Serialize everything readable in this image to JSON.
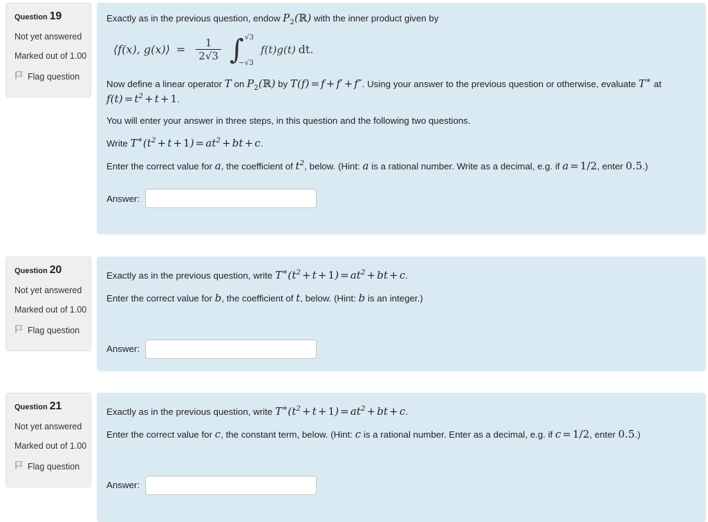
{
  "questions": [
    {
      "heading_label": "Question",
      "number": "19",
      "state": "Not yet answered",
      "grade": "Marked out of 1.00",
      "flag_label": "Flag question",
      "flag_icon": "flag-icon",
      "intro_before_math": "Exactly as in the previous question, endow ",
      "intro_math": "P₂(ℝ)",
      "intro_after_math": " with the inner product given by",
      "equation": {
        "lhs": "⟨f(x), g(x)⟩",
        "equals": "=",
        "fraction_numerator": "1",
        "fraction_denominator": "2√3",
        "integral_upper": "√3",
        "integral_lower": "−√3",
        "integrand": "f(t)g(t)",
        "differential": "dt."
      },
      "para_operator": {
        "t1": "Now define a linear operator ",
        "m1": "T",
        "t2": " on ",
        "m2": "P₂(ℝ)",
        "t3": " by ",
        "m3": "T(f) = f + f′ + f″",
        "t4": ". Using your answer to the previous question or otherwise, evaluate ",
        "m4": "T*",
        "t5": " at ",
        "m5": "f(t) = t² + t + 1",
        "t6": "."
      },
      "para_steps": "You will enter your answer in three steps, in this question and the following two questions.",
      "para_write": {
        "t1": "Write ",
        "m1": "T*(t² + t + 1) = at² + bt + c",
        "t2": "."
      },
      "para_enter": {
        "t1": "Enter the correct value for ",
        "m1": "a",
        "t2": ", the coefficient of ",
        "m2": "t²",
        "t3": ", below. (Hint: ",
        "m3": "a",
        "t4": " is a rational number. Write as a decimal, e.g. if ",
        "m4": "a = 1/2",
        "t5": ", enter ",
        "m5": "0.5",
        "t6": ".)"
      },
      "answer_label": "Answer:",
      "answer_value": "",
      "answer_placeholder": ""
    },
    {
      "heading_label": "Question",
      "number": "20",
      "state": "Not yet answered",
      "grade": "Marked out of 1.00",
      "flag_label": "Flag question",
      "flag_icon": "flag-icon",
      "para_write": {
        "t1": "Exactly as in the previous question, write ",
        "m1": "T*(t² + t + 1) = at² + bt + c",
        "t2": "."
      },
      "para_enter": {
        "t1": "Enter the correct value for ",
        "m1": "b",
        "t2": ", the coefficient of ",
        "m2": "t",
        "t3": ", below. (Hint: ",
        "m3": "b",
        "t4": " is an integer.)"
      },
      "answer_label": "Answer:",
      "answer_value": "",
      "answer_placeholder": ""
    },
    {
      "heading_label": "Question",
      "number": "21",
      "state": "Not yet answered",
      "grade": "Marked out of 1.00",
      "flag_label": "Flag question",
      "flag_icon": "flag-icon",
      "para_write": {
        "t1": "Exactly as in the previous question, write ",
        "m1": "T*(t² + t + 1) = at² + bt + c",
        "t2": "."
      },
      "para_enter": {
        "t1": "Enter the correct value for ",
        "m1": "c",
        "t2": ", the constant term, below. (Hint: ",
        "m3": "c",
        "t4": " is a rational number. Enter as a decimal, e.g. if ",
        "m4": "c = 1/2",
        "t5": ", enter ",
        "m5": "0.5",
        "t6": ".)"
      },
      "answer_label": "Answer:",
      "answer_value": "",
      "answer_placeholder": ""
    }
  ],
  "colors": {
    "content_panel_bg": "#daeaf2",
    "info_panel_bg": "#efefef",
    "text": "#333333",
    "input_border": "#c7c7c7",
    "page_bg": "#ffffff"
  }
}
